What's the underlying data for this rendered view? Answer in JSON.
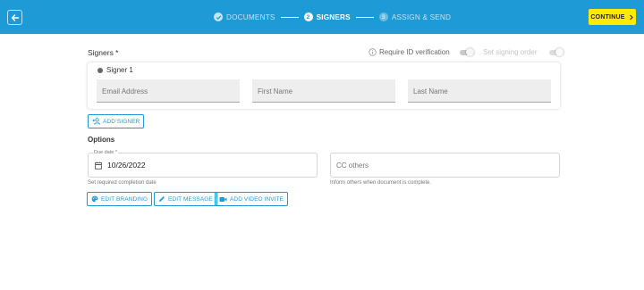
{
  "header": {
    "steps": [
      {
        "label": "DOCUMENTS",
        "marker": "✓"
      },
      {
        "label": "SIGNERS",
        "marker": "2"
      },
      {
        "label": "ASSIGN & SEND",
        "marker": "3"
      }
    ],
    "continue_label": "CONTINUE",
    "accent_color": "#1e9ad6",
    "continue_color": "#ffea00"
  },
  "signers": {
    "title": "Signers *",
    "require_id_label": "Require ID verification",
    "signing_order_label": "Set signing order",
    "require_id_enabled": false,
    "signing_order_enabled": false,
    "signer_name": "Signer 1",
    "email_placeholder": "Email Address",
    "first_name_placeholder": "First Name",
    "last_name_placeholder": "Last Name",
    "add_signer_label": "ADD SIGNER"
  },
  "options": {
    "title": "Options",
    "due_date_label": "Due date *",
    "due_date_value": "10/26/2022",
    "due_date_help": "Set required completion date",
    "cc_placeholder": "CC others",
    "cc_help": "Inform others when document is complete.",
    "buttons": {
      "branding": "EDIT BRANDING",
      "message": "EDIT MESSAGE",
      "video": "ADD VIDEO INVITE"
    }
  }
}
